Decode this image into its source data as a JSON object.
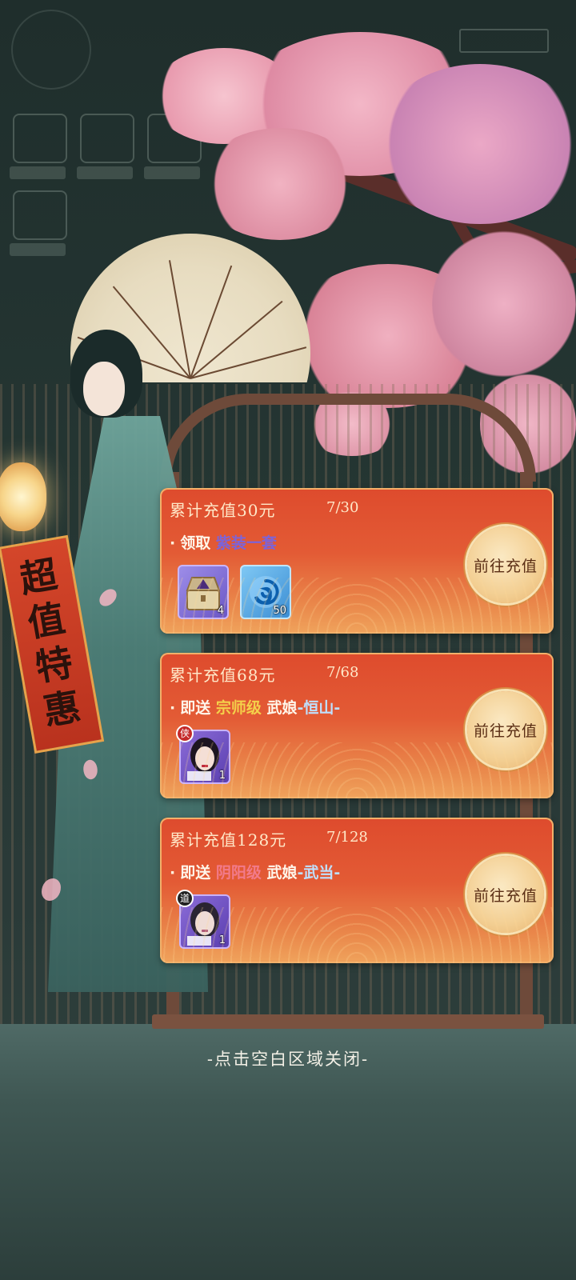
{
  "background": {
    "accent_pink": "#f2a7bf",
    "teal": "#2a3a38"
  },
  "banner": {
    "text": "超值特惠"
  },
  "rewards": [
    {
      "title": "累计充值30元",
      "progress": "7/30",
      "action": "领取",
      "reward_text": "紫装一套",
      "items": [
        {
          "icon": "treasure-chest-icon",
          "qty": "4"
        },
        {
          "icon": "swirl-orb-icon",
          "qty": "50"
        }
      ],
      "button": "前往充值"
    },
    {
      "title": "累计充值68元",
      "progress": "7/68",
      "action": "即送",
      "grade": "宗师级",
      "hero_prefix": "武娘",
      "hero_name": "-恒山-",
      "items": [
        {
          "icon": "heroine-portrait-icon",
          "badge": "侠",
          "qty": "1"
        }
      ],
      "button": "前往充值"
    },
    {
      "title": "累计充值128元",
      "progress": "7/128",
      "action": "即送",
      "grade": "阴阳级",
      "hero_prefix": "武娘",
      "hero_name": "-武当-",
      "items": [
        {
          "icon": "heroine-portrait-icon",
          "badge": "道",
          "qty": "1"
        }
      ],
      "button": "前往充值"
    }
  ],
  "close_hint": "-点击空白区域关闭-"
}
